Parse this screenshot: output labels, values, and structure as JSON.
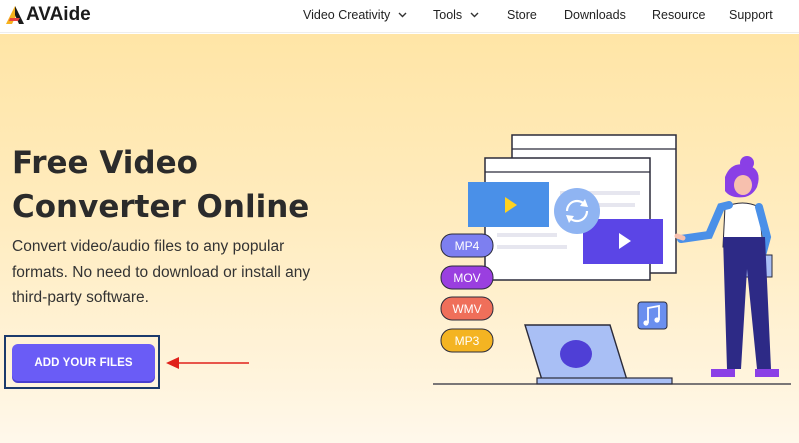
{
  "brand": {
    "name": "AVAide"
  },
  "nav": {
    "items": [
      {
        "label": "Video Creativity",
        "has_dropdown": true
      },
      {
        "label": "Tools",
        "has_dropdown": true
      },
      {
        "label": "Store",
        "has_dropdown": false
      },
      {
        "label": "Downloads",
        "has_dropdown": false
      },
      {
        "label": "Resource",
        "has_dropdown": false
      },
      {
        "label": "Support",
        "has_dropdown": false
      }
    ]
  },
  "hero": {
    "title_line1": "Free Video",
    "title_line2": "Converter Online",
    "description": "Convert video/audio files to any popular formats. No need to download or install any third-party software.",
    "cta_label": "ADD YOUR FILES"
  },
  "formats": [
    "MP4",
    "MOV",
    "WMV",
    "MP3"
  ],
  "colors": {
    "accent": "#6a5cf6",
    "highlight_border": "#1b3a6b",
    "arrow": "#e0211b",
    "hero_bg_top": "#ffe5a6",
    "mp4": "#7d7ff0",
    "mov": "#9a3fe0",
    "wmv": "#ef6f5a",
    "mp3": "#f4b422"
  },
  "icons": [
    "logo-icon",
    "chevron-down-icon",
    "play-icon",
    "refresh-icon",
    "music-note-icon",
    "arrow-left-icon"
  ]
}
